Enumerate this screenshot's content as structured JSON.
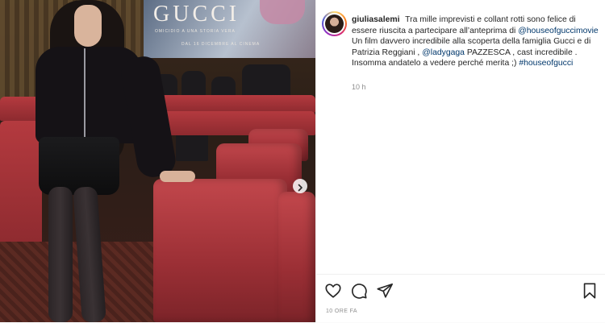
{
  "post": {
    "username": "giuliasalemi",
    "caption_parts": [
      {
        "type": "text",
        "value": " Tra mille imprevisti e collant rotti sono felice di essere riuscita a partecipare all’anteprima di "
      },
      {
        "type": "mention",
        "value": "@houseofguccimovie"
      },
      {
        "type": "text",
        "value": " Un film davvero incredibile alla scoperta della famiglia Gucci e di Patrizia Reggiani , "
      },
      {
        "type": "mention",
        "value": "@ladygaga"
      },
      {
        "type": "text",
        "value": " PAZZESCA , cast incredibile . Insomma andatelo a vedere perché merita ;) "
      },
      {
        "type": "mention",
        "value": "#houseofgucci"
      }
    ],
    "time_ago": "10 h",
    "posted_label": "10 ORE FA"
  },
  "screen": {
    "title": "GUCCI",
    "subtitle": "OMICIDIO A UNA STORIA VERA",
    "date": "DAL 16 DICEMBRE AL CINEMA"
  },
  "icons": {
    "like": "heart-icon",
    "comment": "comment-icon",
    "share": "send-icon",
    "save": "bookmark-icon",
    "next": "chevron-right-icon"
  },
  "colors": {
    "link": "#00376b",
    "text": "#262626",
    "muted": "#8e8e8e"
  }
}
